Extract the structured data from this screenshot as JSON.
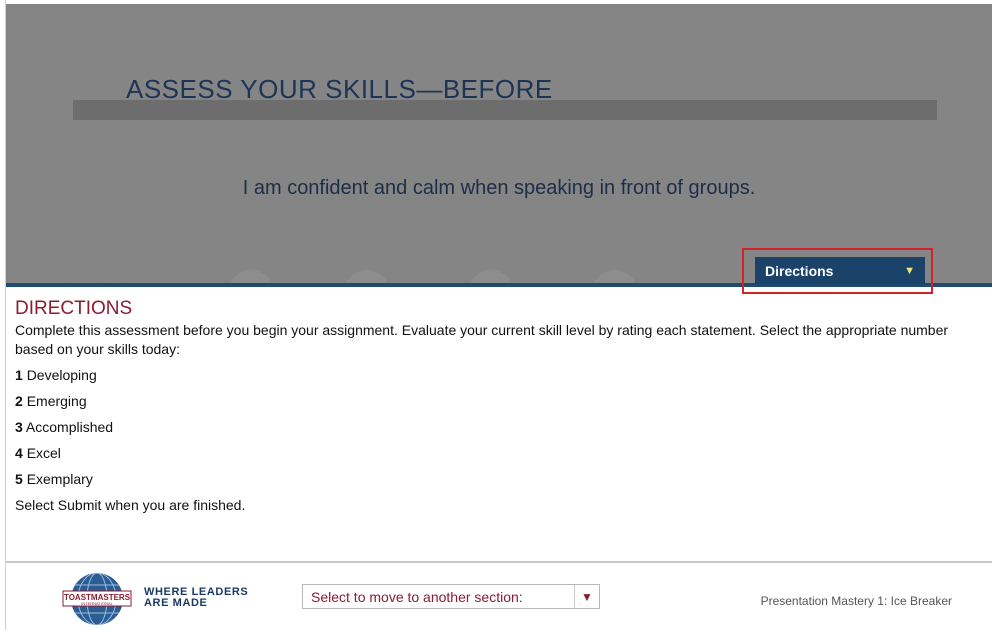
{
  "page": {
    "title": "ASSESS YOUR SKILLS—BEFORE",
    "statement": "I am confident and calm when speaking in front of groups."
  },
  "directions_button": {
    "label": "Directions",
    "caret": "▼"
  },
  "directions_panel": {
    "heading": "DIRECTIONS",
    "text": "Complete this assessment before you begin your assignment. Evaluate your current skill level by rating each statement. Select the appropriate number based on your skills today:",
    "ratings": [
      {
        "number": "1",
        "label": "Developing"
      },
      {
        "number": "2",
        "label": "Emerging"
      },
      {
        "number": "3",
        "label": "Accomplished"
      },
      {
        "number": "4",
        "label": "Excel"
      },
      {
        "number": "5",
        "label": "Exemplary"
      }
    ],
    "finish": "Select Submit when you are finished."
  },
  "footer": {
    "logo_text": "TOASTMASTERS",
    "logo_subtext": "INTERNATIONAL",
    "tagline_line1": "WHERE LEADERS",
    "tagline_line2": "ARE MADE",
    "section_select": "Select to move to another section:",
    "section_caret": "▼",
    "course_title": "Presentation Mastery 1: Ice Breaker"
  },
  "colors": {
    "accent_blue": "#1b4268",
    "heading_maroon": "#8a1d32",
    "highlight_red": "#d1232a"
  }
}
